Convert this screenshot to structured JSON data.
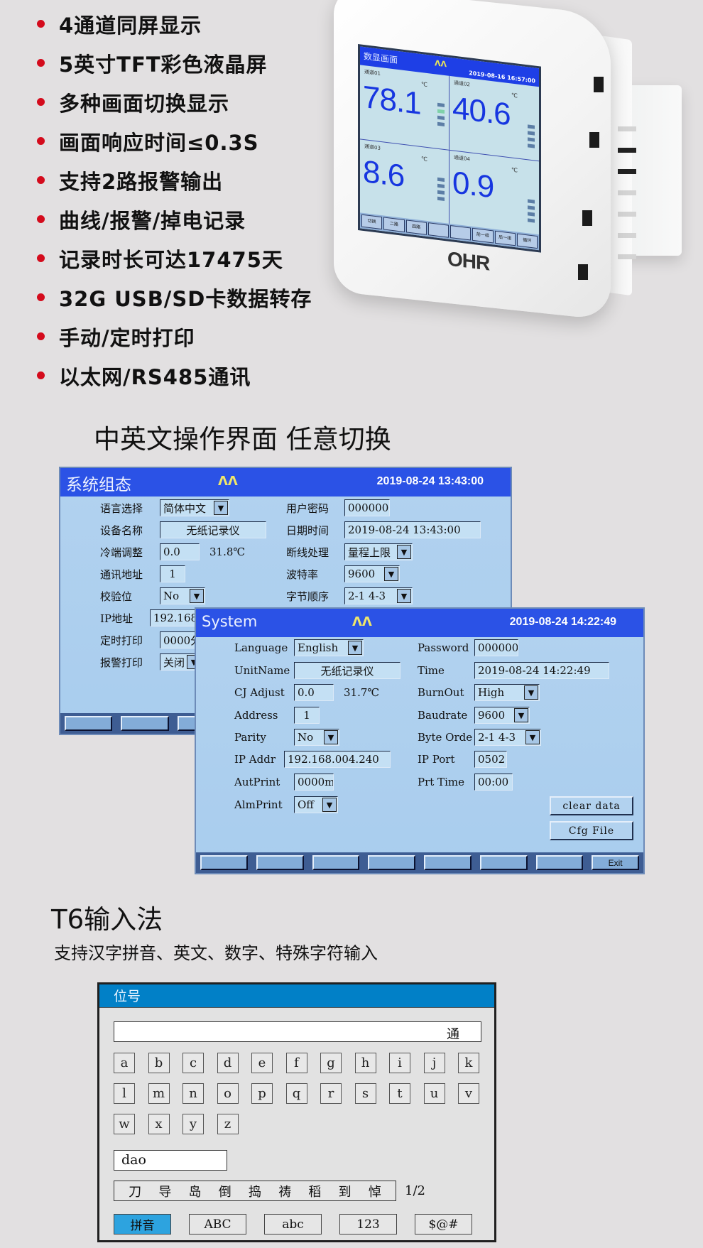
{
  "features": [
    "4通道同屏显示",
    "5英寸TFT彩色液晶屏",
    "多种画面切换显示",
    "画面响应时间≤0.3S",
    "支持2路报警输出",
    "曲线/报警/掉电记录",
    "记录时长可达17475天",
    "32G USB/SD卡数据转存",
    "手动/定时打印",
    "以太网/RS485通讯"
  ],
  "colors": {
    "bullet": "#d40b1c",
    "header_blue": "#2b52e6",
    "panel_blue": "#b2d2ef",
    "ime_header": "#0180c7",
    "ime_active": "#2da3df"
  },
  "device": {
    "brand": "OHR",
    "screen": {
      "title": "数显画面",
      "logo": "ɅɅ",
      "datetime": "2019-08-16 16:57:00",
      "channels": [
        {
          "label": "通道01",
          "value": "78.1",
          "unit": "℃"
        },
        {
          "label": "通道02",
          "value": "40.6",
          "unit": "℃"
        },
        {
          "label": "通道03",
          "value": "8.6",
          "unit": "℃"
        },
        {
          "label": "通道04",
          "value": "0.9",
          "unit": "℃"
        }
      ],
      "buttons": [
        "切换",
        "二路",
        "四路",
        "",
        "",
        "前一组",
        "后一组",
        "循环"
      ]
    }
  },
  "section1": {
    "title": "中英文操作界面  任意切换"
  },
  "cn_panel": {
    "title": "系统组态",
    "logo": "ɅɅ",
    "datetime": "2019-08-24 13:43:00",
    "left": [
      {
        "label": "语言选择",
        "value": "简体中文",
        "type": "dropdown"
      },
      {
        "label": "设备名称",
        "value": "无纸记录仪",
        "type": "text"
      },
      {
        "label": "冷端调整",
        "value": "0.0",
        "extra": "31.8℃",
        "type": "text"
      },
      {
        "label": "通讯地址",
        "value": "1",
        "type": "text"
      },
      {
        "label": "校验位",
        "value": "No",
        "type": "dropdown"
      },
      {
        "label": "IP地址",
        "value": "192.168",
        "type": "text"
      },
      {
        "label": "定时打印",
        "value": "0000分",
        "type": "text"
      },
      {
        "label": "报警打印",
        "value": "关闭",
        "type": "dropdown"
      }
    ],
    "right": [
      {
        "label": "用户密码",
        "value": "000000",
        "type": "text"
      },
      {
        "label": "日期时间",
        "value": "2019-08-24 13:43:00",
        "type": "text"
      },
      {
        "label": "断线处理",
        "value": "量程上限",
        "type": "dropdown"
      },
      {
        "label": "波特率",
        "value": "9600",
        "type": "dropdown"
      },
      {
        "label": "字节顺序",
        "value": "2-1 4-3",
        "type": "dropdown"
      }
    ]
  },
  "en_panel": {
    "title": "System",
    "logo": "ɅɅ",
    "datetime": "2019-08-24 14:22:49",
    "left": [
      {
        "label": "Language",
        "value": "English",
        "type": "dropdown"
      },
      {
        "label": "UnitName",
        "value": "无纸记录仪",
        "type": "text"
      },
      {
        "label": "CJ Adjust",
        "value": "0.0",
        "extra": "31.7℃",
        "type": "text"
      },
      {
        "label": "Address",
        "value": "1",
        "type": "text"
      },
      {
        "label": "Parity",
        "value": "No",
        "type": "dropdown"
      },
      {
        "label": "IP Addr",
        "value": "192.168.004.240",
        "type": "text"
      },
      {
        "label": "AutPrint",
        "value": "0000m",
        "type": "text"
      },
      {
        "label": "AlmPrint",
        "value": "Off",
        "type": "dropdown"
      }
    ],
    "right": [
      {
        "label": "Password",
        "value": "000000",
        "type": "text"
      },
      {
        "label": "Time",
        "value": "2019-08-24 14:22:49",
        "type": "text"
      },
      {
        "label": "BurnOut",
        "value": "High",
        "type": "dropdown"
      },
      {
        "label": "Baudrate",
        "value": "9600",
        "type": "dropdown"
      },
      {
        "label": "Byte Orde",
        "value": "2-1 4-3",
        "type": "dropdown"
      },
      {
        "label": "IP Port",
        "value": "0502",
        "type": "text"
      },
      {
        "label": "Prt Time",
        "value": "00:00",
        "type": "text"
      }
    ],
    "clear_data": "clear data",
    "cfg_file": "Cfg File",
    "footer_buttons": [
      "",
      "",
      "",
      "",
      "",
      "",
      "",
      "Exit"
    ]
  },
  "section2": {
    "title": "T6输入法",
    "subtitle": "支持汉字拼音、英文、数字、特殊字符输入"
  },
  "ime": {
    "title": "位号",
    "input_value": "通",
    "keys": [
      "a",
      "b",
      "c",
      "d",
      "e",
      "f",
      "g",
      "h",
      "i",
      "j",
      "k",
      "l",
      "m",
      "n",
      "o",
      "p",
      "q",
      "r",
      "s",
      "t",
      "u",
      "v",
      "w",
      "x",
      "y",
      "z"
    ],
    "pinyin": "dao",
    "candidates": [
      "刀",
      "导",
      "岛",
      "倒",
      "捣",
      "祷",
      "稻",
      "到",
      "悼"
    ],
    "page": "1/2",
    "modes": [
      {
        "label": "拼音",
        "active": true
      },
      {
        "label": "ABC",
        "active": false
      },
      {
        "label": "abc",
        "active": false
      },
      {
        "label": "123",
        "active": false
      },
      {
        "label": "$@#",
        "active": false
      }
    ]
  }
}
